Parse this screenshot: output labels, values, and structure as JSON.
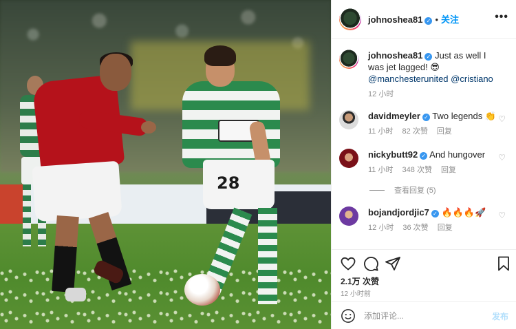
{
  "header": {
    "username": "johnoshea81",
    "separator": "•",
    "follow_label": "关注",
    "more_icon": "more-horizontal-icon"
  },
  "caption": {
    "username": "johnoshea81",
    "text": "Just as well I was jet lagged! 😎",
    "mentions": [
      "@manchesterunited",
      "@cristiano"
    ],
    "time": "12 小时"
  },
  "comments": [
    {
      "username": "davidmeyler",
      "text": "Two legends 👏",
      "time": "11 小时",
      "likes": "82 次赞",
      "reply": "回复"
    },
    {
      "username": "nickybutt92",
      "text": "And hungover",
      "time": "11 小时",
      "likes": "348 次赞",
      "reply": "回复"
    },
    {
      "username": "bojandjordjic7",
      "text": "🔥🔥🔥🚀",
      "time": "12 小时",
      "likes": "36 次赞",
      "reply": "回复"
    }
  ],
  "view_replies": "查看回复 (5)",
  "photo": {
    "jersey_number": "28"
  },
  "actions": {
    "like_count": "2.1万 次赞",
    "post_time": "12 小时前"
  },
  "add_comment": {
    "placeholder": "添加评论...",
    "post_label": "发布"
  },
  "colors": {
    "verified": "#3897f0",
    "link": "#00376b",
    "follow": "#0095f6",
    "muted": "#8e8e8e"
  }
}
